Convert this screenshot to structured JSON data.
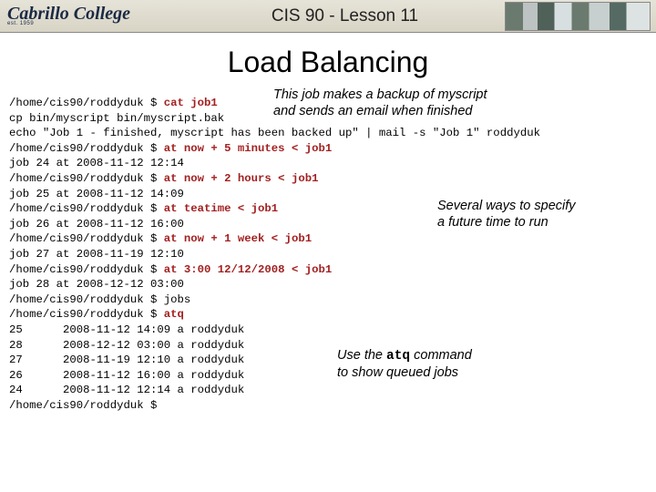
{
  "header": {
    "logo_text": "Cabrillo College",
    "logo_sub": "est. 1959",
    "title": "CIS 90 - Lesson 11"
  },
  "slide": {
    "title": "Load Balancing"
  },
  "prompt": "/home/cis90/roddyduk $ ",
  "term": {
    "l01_cmd": "cat job1",
    "l02": "cp bin/myscript bin/myscript.bak",
    "l03": "echo \"Job 1 - finished, myscript has been backed up\" | mail -s \"Job 1\" roddyduk",
    "l04_cmd": "at now + 5 minutes < job1",
    "l05": "job 24 at 2008-11-12 12:14",
    "l06_cmd": "at now + 2 hours < job1",
    "l07": "job 25 at 2008-11-12 14:09",
    "l08_cmd": "at teatime < job1",
    "l09": "job 26 at 2008-11-12 16:00",
    "l10_cmd": "at now + 1 week < job1",
    "l11": "job 27 at 2008-11-19 12:10",
    "l12_cmd": "at 3:00 12/12/2008 < job1",
    "l13": "job 28 at 2008-12-12 03:00",
    "l14": "/home/cis90/roddyduk $ jobs",
    "l15_cmd": "atq",
    "q1": "25      2008-11-12 14:09 a roddyduk",
    "q2": "28      2008-12-12 03:00 a roddyduk",
    "q3": "27      2008-11-19 12:10 a roddyduk",
    "q4": "26      2008-11-12 16:00 a roddyduk",
    "q5": "24      2008-11-12 12:14 a roddyduk"
  },
  "anno": {
    "a1_l1": "This job makes a backup of myscript",
    "a1_l2": "and sends an email when finished",
    "a2_l1": "Several ways to specify",
    "a2_l2": "a future time to run",
    "a3_pre": "Use the ",
    "a3_code": "atq",
    "a3_post": " command",
    "a3_l2": "to show queued jobs"
  }
}
